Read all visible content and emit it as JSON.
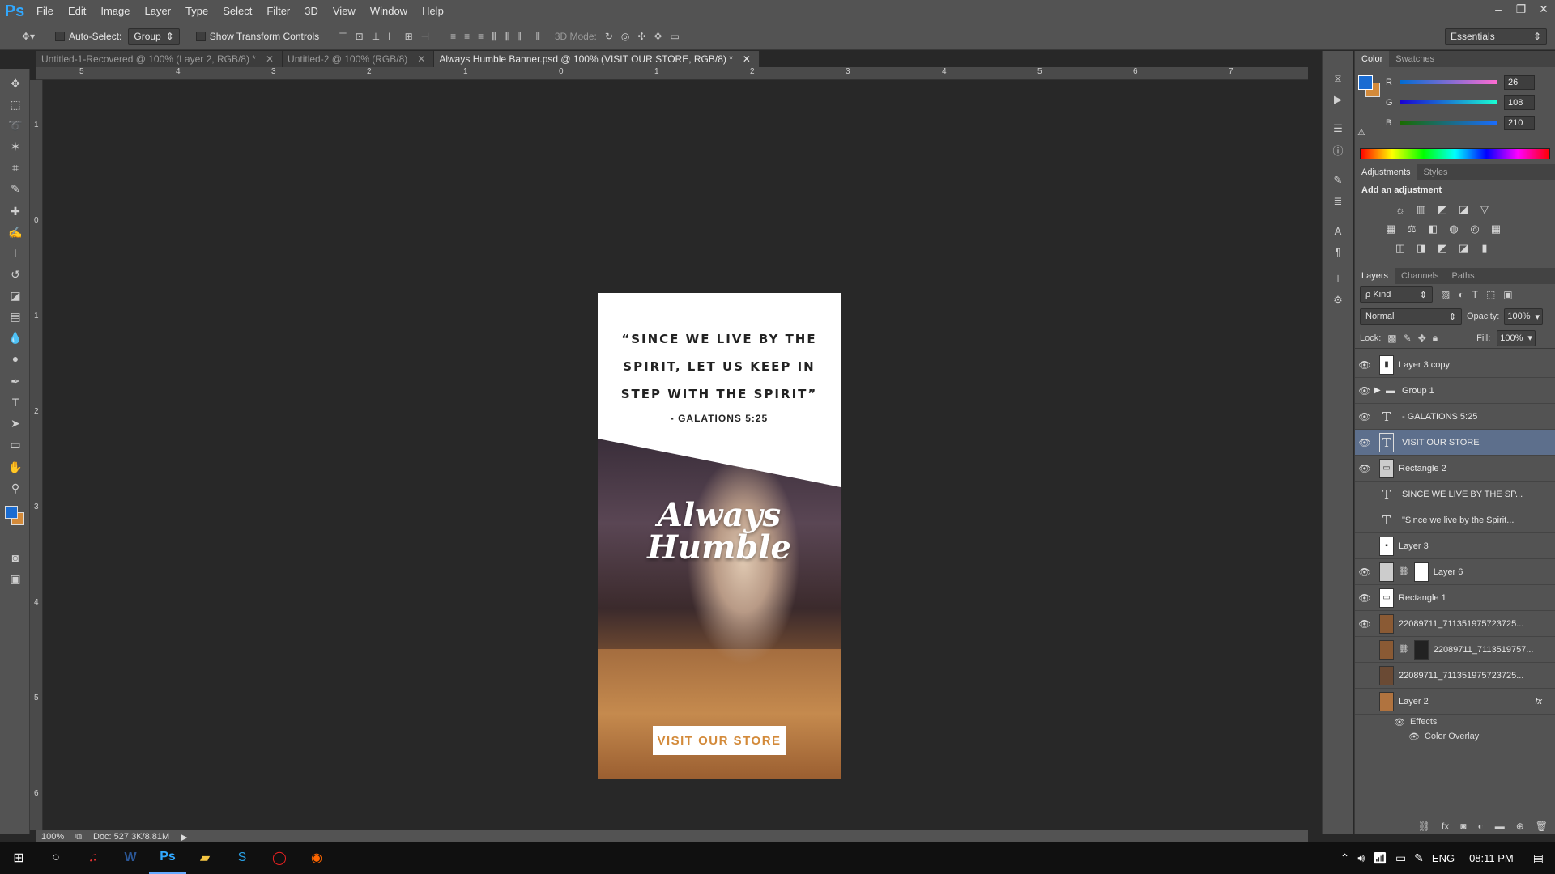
{
  "app": {
    "logo": "Ps"
  },
  "menu": [
    "File",
    "Edit",
    "Image",
    "Layer",
    "Type",
    "Select",
    "Filter",
    "3D",
    "View",
    "Window",
    "Help"
  ],
  "window_controls": [
    "–",
    "❐",
    "✕"
  ],
  "options": {
    "auto_select_label": "Auto-Select:",
    "auto_select_value": "Group",
    "show_transform_label": "Show Transform Controls",
    "mode_3d_label": "3D Mode:",
    "workspace": "Essentials"
  },
  "tabs": [
    {
      "label": "Untitled-1-Recovered @ 100% (Layer 2, RGB/8) *"
    },
    {
      "label": "Untitled-2 @ 100% (RGB/8)"
    },
    {
      "label": "Always Humble Banner.psd @ 100% (VISIT OUR STORE, RGB/8) *"
    }
  ],
  "ruler_h": [
    "5",
    "4",
    "3",
    "2",
    "1",
    "0",
    "1",
    "2",
    "3",
    "4",
    "5",
    "6",
    "7"
  ],
  "ruler_v": [
    "1",
    "0",
    "1",
    "2",
    "3",
    "4",
    "5",
    "6"
  ],
  "document": {
    "quote_lines": [
      "“SINCE WE LIVE BY THE",
      "SPIRIT, LET US KEEP IN",
      "STEP WITH THE SPIRIT”"
    ],
    "reference": "- GALATIONS 5:25",
    "logo_line1": "Always",
    "logo_line2": "Humble",
    "cta": "VISIT OUR STORE"
  },
  "status": {
    "zoom": "100%",
    "doc": "Doc: 527.3K/8.81M"
  },
  "color_panel": {
    "tabs": [
      "Color",
      "Swatches"
    ],
    "fg_color": "#1a6cd2",
    "bg_color": "#d38a3a",
    "channels": [
      {
        "label": "R",
        "value": "26"
      },
      {
        "label": "G",
        "value": "108"
      },
      {
        "label": "B",
        "value": "210"
      }
    ]
  },
  "adjustments_panel": {
    "tabs": [
      "Adjustments",
      "Styles"
    ],
    "title": "Add an adjustment",
    "icons_row1": [
      "☼",
      "▥",
      "◩",
      "◪",
      "▽"
    ],
    "icons_row2": [
      "▦",
      "⚖",
      "◧",
      "◍",
      "◎",
      "▦"
    ],
    "icons_row3": [
      "◫",
      "◨",
      "◩",
      "◪",
      "▮"
    ]
  },
  "layers_panel": {
    "tabs": [
      "Layers",
      "Channels",
      "Paths"
    ],
    "filter_kind": "ρ Kind",
    "blend_mode": "Normal",
    "opacity_label": "Opacity:",
    "opacity_value": "100%",
    "lock_label": "Lock:",
    "fill_label": "Fill:",
    "fill_value": "100%",
    "layers": [
      {
        "name": "Layer 3 copy",
        "visible": true,
        "type": "raster"
      },
      {
        "name": "Group 1",
        "visible": true,
        "type": "group"
      },
      {
        "name": "- GALATIONS 5:25",
        "visible": true,
        "type": "text"
      },
      {
        "name": "VISIT OUR STORE",
        "visible": true,
        "type": "text",
        "selected": true
      },
      {
        "name": "Rectangle 2",
        "visible": true,
        "type": "shape"
      },
      {
        "name": "SINCE WE LIVE BY THE SP...",
        "visible": false,
        "type": "text"
      },
      {
        "name": "\"Since we live by the Spirit...",
        "visible": false,
        "type": "text"
      },
      {
        "name": "Layer 3",
        "visible": false,
        "type": "raster"
      },
      {
        "name": "Layer 6",
        "visible": true,
        "type": "masked"
      },
      {
        "name": "Rectangle 1",
        "visible": true,
        "type": "shape"
      },
      {
        "name": "22089711_711351975723725...",
        "visible": true,
        "type": "photo"
      },
      {
        "name": "22089711_7113519757...",
        "visible": false,
        "type": "photo-masked"
      },
      {
        "name": "22089711_711351975723725...",
        "visible": false,
        "type": "photo"
      },
      {
        "name": "Layer 2",
        "visible": false,
        "type": "raster",
        "fx": true
      }
    ],
    "effects_label": "Effects",
    "effect_item": "Color Overlay",
    "fx_badge": "fx"
  },
  "taskbar": {
    "language": "ENG",
    "time": "08:11 PM"
  }
}
